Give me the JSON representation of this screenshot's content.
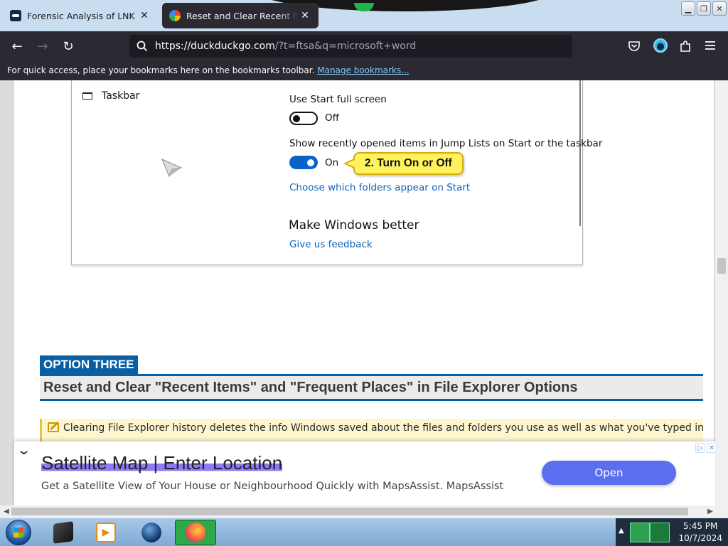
{
  "browser": {
    "tabs": [
      {
        "title": "Forensic Analysis of LNK Files",
        "active": false
      },
      {
        "title": "Reset and Clear Recent Items and Frequent Places",
        "active": true
      }
    ],
    "url_host": "https://duckduckgo.com",
    "url_rest": "/?t=ftsa&q=microsoft+word",
    "bookmarks_message": "For quick access, place your bookmarks here on the bookmarks toolbar.",
    "bookmarks_link": "Manage bookmarks...",
    "accent_color": "#2b2a33"
  },
  "screenshot": {
    "sidebar_item": "Taskbar",
    "setting1_label": "Use Start full screen",
    "setting1_state": "Off",
    "setting2_label": "Show recently opened items in Jump Lists on Start or the taskbar",
    "setting2_state": "On",
    "callout": "2. Turn On or Off",
    "link1": "Choose which folders appear on Start",
    "heading": "Make Windows better",
    "link2": "Give us feedback"
  },
  "article": {
    "option_tag": "OPTION THREE",
    "title": "Reset and Clear \"Recent Items\" and \"Frequent Places\" in File Explorer Options",
    "note": "Clearing File Explorer history deletes the info Windows saved about the files and folders you use as well as what you've typed in the address bar."
  },
  "ad": {
    "title": "Satellite Map | Enter Location",
    "description": "Get a Satellite View of Your House or Neighbourhood Quickly with MapsAssist. MapsAssist",
    "button": "Open",
    "button_color": "#5b6ef0"
  },
  "taskbar": {
    "time": "5:45 PM",
    "date": "10/7/2024",
    "apps": [
      "terminal-icon",
      "media-player-icon",
      "globe-icon",
      "firefox-icon"
    ]
  }
}
